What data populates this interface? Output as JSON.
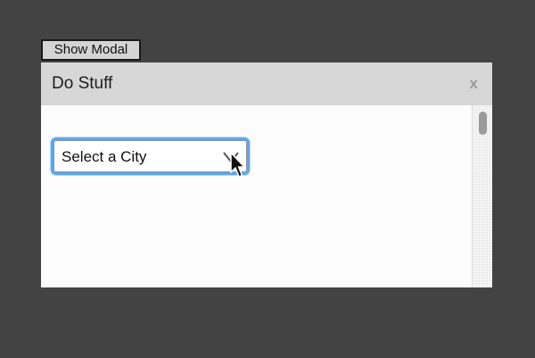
{
  "page": {
    "show_modal_label": "Show Modal"
  },
  "modal": {
    "title": "Do Stuff",
    "close_label": "x",
    "city_select": {
      "selected": "Select a City",
      "options": [
        "Select a City"
      ]
    }
  },
  "colors": {
    "backdrop": "#444344",
    "header": "#d8d7d8",
    "focus_ring": "#5aa8f0",
    "close": "#9a9a9a"
  },
  "icons": {
    "dropdown": "chevron-down-icon",
    "pointer": "mouse-cursor-icon"
  }
}
